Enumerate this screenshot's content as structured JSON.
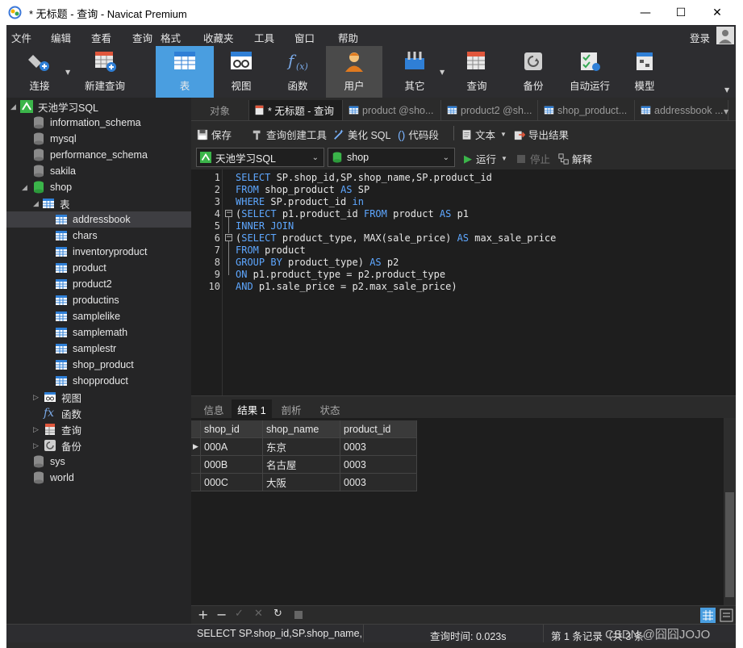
{
  "window": {
    "title": "* 无标题 - 查询 - Navicat Premium"
  },
  "menu": [
    "文件",
    "编辑",
    "查看",
    "查询",
    "格式",
    "收藏夹",
    "工具",
    "窗口",
    "帮助"
  ],
  "login_label": "登录",
  "toolbar": [
    "连接",
    "新建查询",
    "表",
    "视图",
    "函数",
    "用户",
    "其它",
    "查询",
    "备份",
    "自动运行",
    "模型"
  ],
  "sidebar": {
    "connection": "天池学习SQL",
    "dbs_top": [
      "information_schema",
      "mysql",
      "performance_schema",
      "sakila",
      "shop"
    ],
    "tables_group": "表",
    "tables": [
      "addressbook",
      "chars",
      "inventoryproduct",
      "product",
      "product2",
      "productins",
      "samplelike",
      "samplemath",
      "samplestr",
      "shop_product",
      "shopproduct"
    ],
    "objects": [
      "视图",
      "函数",
      "查询",
      "备份"
    ],
    "dbs_bottom": [
      "sys",
      "world"
    ]
  },
  "tabs": [
    "对象",
    "* 无标题 - 查询",
    "product @sho...",
    "product2 @sh...",
    "shop_product...",
    "addressbook ..."
  ],
  "query_toolbar": {
    "save": "保存",
    "builder": "查询创建工具",
    "beautify": "美化 SQL",
    "snippet": "代码段",
    "text": "文本",
    "export": "导出结果"
  },
  "connection_select": "天池学习SQL",
  "database_select": "shop",
  "run": "运行",
  "stop": "停止",
  "explain": "解释",
  "sql_lines": [
    "SELECT SP.shop_id,SP.shop_name,SP.product_id",
    "FROM shop_product AS SP",
    "WHERE SP.product_id in",
    "(SELECT p1.product_id FROM product AS p1",
    "INNER JOIN",
    "(SELECT product_type, MAX(sale_price) AS max_sale_price",
    "FROM product",
    "GROUP BY product_type) AS p2",
    "ON p1.product_type = p2.product_type",
    "AND p1.sale_price = p2.max_sale_price)"
  ],
  "line_numbers": [
    "1",
    "2",
    "3",
    "4",
    "5",
    "6",
    "7",
    "8",
    "9",
    "10"
  ],
  "result_tabs": [
    "信息",
    "结果 1",
    "剖析",
    "状态"
  ],
  "result": {
    "columns": [
      "shop_id",
      "shop_name",
      "product_id"
    ],
    "rows": [
      [
        "000A",
        "东京",
        "0003"
      ],
      [
        "000B",
        "名古屋",
        "0003"
      ],
      [
        "000C",
        "大阪",
        "0003"
      ]
    ]
  },
  "status": {
    "sql": "SELECT SP.shop_id,SP.shop_name,S",
    "time": "查询时间: 0.023s",
    "records": "第 1 条记录（共 3 条",
    "watermark": "CSDN @囧囧JOJO"
  }
}
